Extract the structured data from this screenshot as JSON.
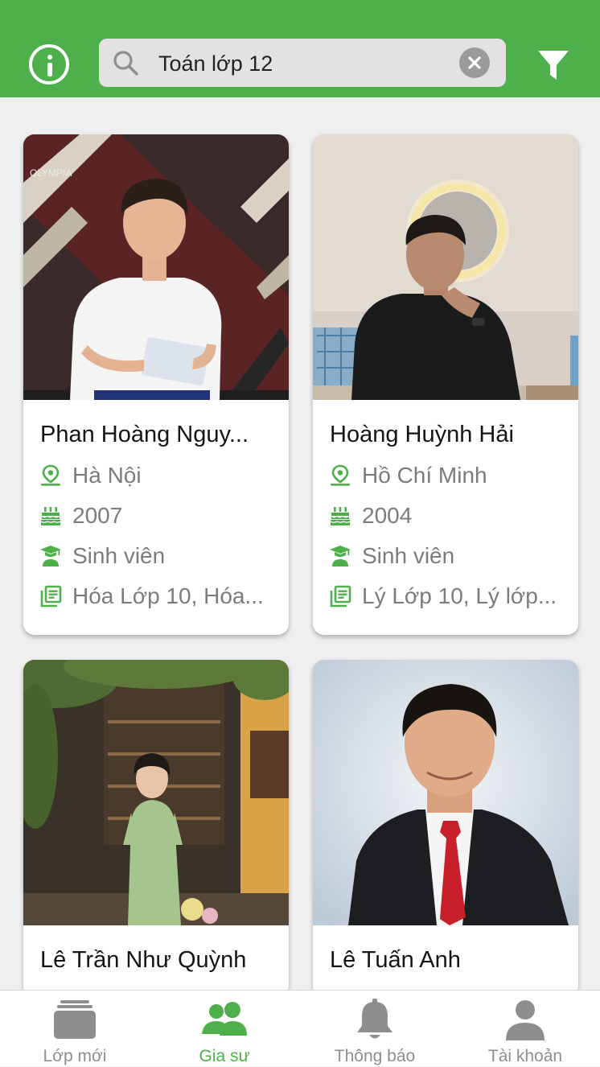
{
  "header": {
    "search_value": "Toán lớp 12",
    "accent_color": "#4db04a",
    "info_icon": "info-icon",
    "filter_icon": "filter-icon",
    "clear_icon": "clear-icon"
  },
  "tutors": [
    {
      "name": "Phan Hoàng Nguy...",
      "location": "Hà Nội",
      "birth_year": "2007",
      "occupation": "Sinh viên",
      "subjects": "Hóa Lớp 10, Hóa..."
    },
    {
      "name": "Hoàng Huỳnh Hải",
      "location": "Hồ Chí Minh",
      "birth_year": "2004",
      "occupation": "Sinh viên",
      "subjects": "Lý Lớp 10, Lý lớp..."
    },
    {
      "name": "Lê Trần Như Quỳnh"
    },
    {
      "name": "Lê Tuấn Anh"
    }
  ],
  "icons": {
    "location": "map-pin-icon",
    "birth": "birthday-cake-icon",
    "occupation": "graduate-icon",
    "subjects": "book-list-icon"
  },
  "bottom_nav": {
    "items": [
      {
        "label": "Lớp mới",
        "icon": "classes-stack-icon",
        "active": false
      },
      {
        "label": "Gia sư",
        "icon": "tutors-group-icon",
        "active": true
      },
      {
        "label": "Thông báo",
        "icon": "bell-icon",
        "active": false
      },
      {
        "label": "Tài khoản",
        "icon": "account-icon",
        "active": false
      }
    ]
  }
}
